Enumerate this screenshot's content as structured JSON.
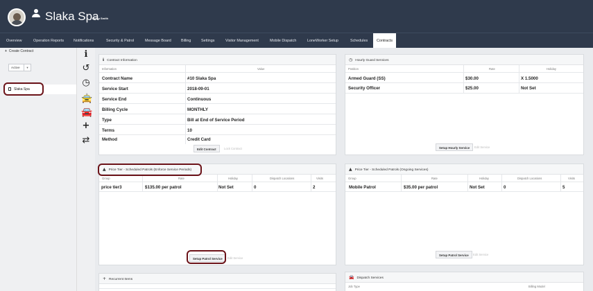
{
  "header": {
    "site_name": "Slaka Spa",
    "user_name": "Helen Smith"
  },
  "nav": {
    "tabs": [
      "Overview",
      "Operation Reports",
      "Notifications",
      "Security & Patrol",
      "Message Board",
      "Billing",
      "Settings",
      "Visitor Management",
      "Mobile Dispatch",
      "LoneWorker Setup",
      "Schedules",
      "Contracts"
    ],
    "active": "Contracts"
  },
  "sidebar": {
    "create_label": "Create Contract",
    "filter_value": "Active",
    "site_item": "Slaka Spa"
  },
  "icons": [
    "info-icon",
    "history-icon",
    "clock-icon",
    "car-icon",
    "car-icon",
    "plus-icon",
    "exchange-icon"
  ],
  "contract_info": {
    "title": "Contract Information",
    "col_info": "Information",
    "col_value": "Value",
    "rows": [
      [
        "Contract Name",
        "#10 Slaka Spa"
      ],
      [
        "Service Start",
        "2018-09-01"
      ],
      [
        "Service End",
        "Continuous"
      ],
      [
        "Billing Cycle",
        "MONTHLY"
      ],
      [
        "Type",
        "Bill at End of Service Period"
      ],
      [
        "Terms",
        "10"
      ],
      [
        "Method",
        "Credit Card"
      ]
    ],
    "edit_button": "Edit Contract",
    "ghost": "Lock Contract"
  },
  "hourly": {
    "title": "Hourly Guard Services",
    "cols": [
      "Position",
      "Rate",
      "Holiday"
    ],
    "rows": [
      [
        "Armed Guard (SS)",
        "$30.00",
        "X 1.5000"
      ],
      [
        "Security Officer",
        "$25.00",
        "Not Set"
      ]
    ],
    "button": "Setup Hourly Service",
    "ghost": "Edit Service"
  },
  "scheduled": {
    "title": "Price Tier - Scheduled Patrols (Enforce Service Periods)",
    "cols": [
      "Group",
      "Rate",
      "Holiday",
      "Dispatch Locations",
      "Visits"
    ],
    "rows": [
      [
        "price tier3",
        "$135.00 per patrol",
        "Not Set",
        "0",
        "2"
      ]
    ],
    "button": "Setup Patrol Service",
    "ghost": "Edit Service"
  },
  "ongoing": {
    "title": "Price Tier - Scheduled Patrols (Ongoing Services)",
    "cols": [
      "Group",
      "Rate",
      "Holiday",
      "Dispatch Locations",
      "Visits"
    ],
    "rows": [
      [
        "Mobile Patrol",
        "$35.00 per patrol",
        "Not Set",
        "0",
        "5"
      ]
    ],
    "button": "Setup Patrol Service",
    "ghost": "Edit Service"
  },
  "recurrent": {
    "title": "Recurrent Items"
  },
  "dispatch": {
    "title": "Dispatch Services",
    "col_job": "Job Type",
    "col_billing": "Billing Model"
  }
}
